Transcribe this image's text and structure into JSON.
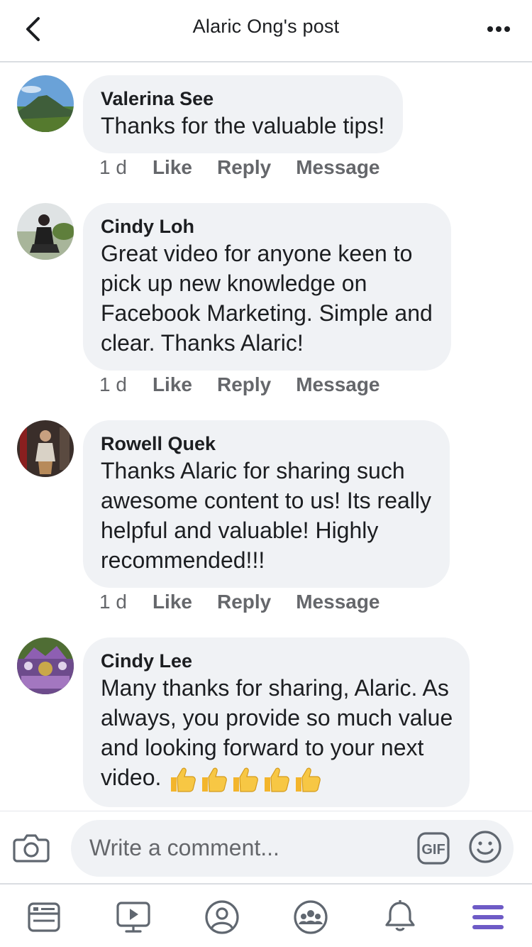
{
  "header": {
    "title": "Alaric Ong's post",
    "back_icon": "chevron-left-icon",
    "more_icon": "more-horizontal-icon"
  },
  "comments": [
    {
      "author": "Valerina See",
      "text": "Thanks for the valuable tips!",
      "time": "1 d",
      "like": "Like",
      "reply": "Reply",
      "message": "Message"
    },
    {
      "author": "Cindy Loh",
      "text": "Great video for anyone keen to\npick up new knowledge on\nFacebook Marketing. Simple and\nclear. Thanks Alaric!",
      "time": "1 d",
      "like": "Like",
      "reply": "Reply",
      "message": "Message"
    },
    {
      "author": "Rowell Quek",
      "text": "Thanks Alaric for sharing such\nawesome content to us! Its really\nhelpful and valuable! Highly\nrecommended!!!",
      "time": "1 d",
      "like": "Like",
      "reply": "Reply",
      "message": "Message"
    },
    {
      "author": "Cindy Lee",
      "text": "Many thanks for sharing, Alaric. As\nalways, you provide so much value\nand looking forward to your next\nvideo.",
      "emoji": "thumbs-up-icon x5"
    }
  ],
  "composer": {
    "placeholder": "Write a comment...",
    "camera_icon": "camera-icon",
    "gif_label": "GIF",
    "emoji_icon": "smiley-icon"
  },
  "tabbar": {
    "items": [
      "news-feed-icon",
      "watch-icon",
      "profile-icon",
      "groups-icon",
      "notifications-icon",
      "menu-icon"
    ],
    "active": "menu-icon",
    "active_color": "#6e5bc6",
    "inactive_color": "#606770"
  }
}
